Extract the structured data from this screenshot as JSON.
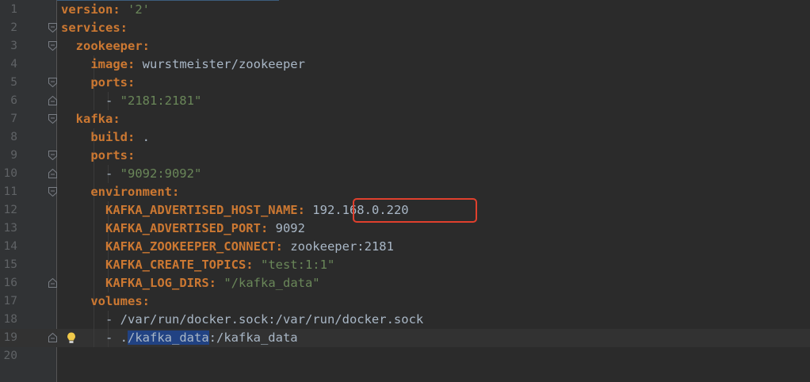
{
  "editor": {
    "lines": [
      {
        "n": "1",
        "segs": [
          {
            "t": "version:",
            "c": "k"
          },
          {
            "t": " ",
            "c": "v"
          },
          {
            "t": "'2'",
            "c": "s"
          }
        ],
        "fold": null,
        "indent": 0
      },
      {
        "n": "2",
        "segs": [
          {
            "t": "services:",
            "c": "k"
          }
        ],
        "fold": "open",
        "indent": 0
      },
      {
        "n": "3",
        "segs": [
          {
            "t": "  ",
            "c": "v"
          },
          {
            "t": "zookeeper:",
            "c": "k"
          }
        ],
        "fold": "open",
        "indent": 1
      },
      {
        "n": "4",
        "segs": [
          {
            "t": "    ",
            "c": "v"
          },
          {
            "t": "image:",
            "c": "k"
          },
          {
            "t": " wurstmeister/zookeeper",
            "c": "v"
          }
        ],
        "fold": null,
        "indent": 2
      },
      {
        "n": "5",
        "segs": [
          {
            "t": "    ",
            "c": "v"
          },
          {
            "t": "ports:",
            "c": "k"
          }
        ],
        "fold": "open",
        "indent": 2
      },
      {
        "n": "6",
        "segs": [
          {
            "t": "      - ",
            "c": "v"
          },
          {
            "t": "\"2181:2181\"",
            "c": "s"
          }
        ],
        "fold": "close",
        "indent": 3
      },
      {
        "n": "7",
        "segs": [
          {
            "t": "  ",
            "c": "v"
          },
          {
            "t": "kafka:",
            "c": "k"
          }
        ],
        "fold": "open",
        "indent": 1
      },
      {
        "n": "8",
        "segs": [
          {
            "t": "    ",
            "c": "v"
          },
          {
            "t": "build:",
            "c": "k"
          },
          {
            "t": " .",
            "c": "v"
          }
        ],
        "fold": null,
        "indent": 2
      },
      {
        "n": "9",
        "segs": [
          {
            "t": "    ",
            "c": "v"
          },
          {
            "t": "ports:",
            "c": "k"
          }
        ],
        "fold": "open",
        "indent": 2
      },
      {
        "n": "10",
        "segs": [
          {
            "t": "      - ",
            "c": "v"
          },
          {
            "t": "\"9092:9092\"",
            "c": "s"
          }
        ],
        "fold": "close",
        "indent": 3
      },
      {
        "n": "11",
        "segs": [
          {
            "t": "    ",
            "c": "v"
          },
          {
            "t": "environment:",
            "c": "k"
          }
        ],
        "fold": "open",
        "indent": 2
      },
      {
        "n": "12",
        "segs": [
          {
            "t": "      ",
            "c": "v"
          },
          {
            "t": "KAFKA_ADVERTISED_HOST_NAME:",
            "c": "k"
          },
          {
            "t": " 192.168.0.220",
            "c": "v"
          }
        ],
        "fold": null,
        "indent": 3
      },
      {
        "n": "13",
        "segs": [
          {
            "t": "      ",
            "c": "v"
          },
          {
            "t": "KAFKA_ADVERTISED_PORT:",
            "c": "k"
          },
          {
            "t": " 9092",
            "c": "v"
          }
        ],
        "fold": null,
        "indent": 3
      },
      {
        "n": "14",
        "segs": [
          {
            "t": "      ",
            "c": "v"
          },
          {
            "t": "KAFKA_ZOOKEEPER_CONNECT:",
            "c": "k"
          },
          {
            "t": " zookeeper:2181",
            "c": "v"
          }
        ],
        "fold": null,
        "indent": 3
      },
      {
        "n": "15",
        "segs": [
          {
            "t": "      ",
            "c": "v"
          },
          {
            "t": "KAFKA_CREATE_TOPICS:",
            "c": "k"
          },
          {
            "t": " ",
            "c": "v"
          },
          {
            "t": "\"test:1:1\"",
            "c": "s"
          }
        ],
        "fold": null,
        "indent": 3
      },
      {
        "n": "16",
        "segs": [
          {
            "t": "      ",
            "c": "v"
          },
          {
            "t": "KAFKA_LOG_DIRS:",
            "c": "k"
          },
          {
            "t": " ",
            "c": "v"
          },
          {
            "t": "\"/kafka_data\"",
            "c": "s"
          }
        ],
        "fold": "close",
        "indent": 3
      },
      {
        "n": "17",
        "segs": [
          {
            "t": "    ",
            "c": "v"
          },
          {
            "t": "volumes:",
            "c": "k"
          }
        ],
        "fold": null,
        "indent": 2
      },
      {
        "n": "18",
        "segs": [
          {
            "t": "      - /var/run/docker.sock:/var/run/docker.sock",
            "c": "v"
          }
        ],
        "fold": null,
        "indent": 3
      },
      {
        "n": "19",
        "segs": [
          {
            "t": "      - .",
            "c": "v"
          },
          {
            "t": "/kafka_data",
            "c": "sel"
          },
          {
            "t": ":/kafka_data",
            "c": "v"
          }
        ],
        "fold": "close",
        "indent": 3,
        "current": true,
        "bulb": true
      },
      {
        "n": "20",
        "segs": [],
        "fold": null,
        "indent": 0
      }
    ],
    "highlighted_value": "192.168.0.220",
    "colors": {
      "background": "#2b2b2b",
      "gutter": "#313335",
      "key": "#cc7832",
      "string": "#6a8759",
      "text": "#a9b7c6",
      "selection": "#214283",
      "highlight_box": "#e0402d"
    }
  }
}
